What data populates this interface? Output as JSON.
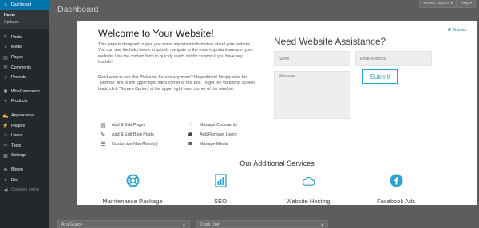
{
  "sidebar": {
    "items": [
      {
        "label": "Dashboard",
        "icon": "dashboard-icon",
        "glyph": "⌂",
        "current": true
      },
      {
        "label": "Posts",
        "icon": "pin-icon",
        "glyph": "✎"
      },
      {
        "label": "Media",
        "icon": "media-icon",
        "glyph": "♫"
      },
      {
        "label": "Pages",
        "icon": "pages-icon",
        "glyph": "▤"
      },
      {
        "label": "Comments",
        "icon": "comments-icon",
        "glyph": "✉"
      },
      {
        "label": "Projects",
        "icon": "projects-icon",
        "glyph": "✢"
      },
      {
        "label": "WooCommerce",
        "icon": "woocommerce-icon",
        "glyph": "◼"
      },
      {
        "label": "Products",
        "icon": "products-icon",
        "glyph": "●"
      },
      {
        "label": "Appearance",
        "icon": "appearance-icon",
        "glyph": "✍"
      },
      {
        "label": "Plugins",
        "icon": "plugins-icon",
        "glyph": "⚡"
      },
      {
        "label": "Users",
        "icon": "users-icon",
        "glyph": "☺"
      },
      {
        "label": "Tools",
        "icon": "tools-icon",
        "glyph": "✂"
      },
      {
        "label": "Settings",
        "icon": "settings-icon",
        "glyph": "▦"
      },
      {
        "label": "Bloom",
        "icon": "bloom-icon",
        "glyph": "✿"
      },
      {
        "label": "Divi",
        "icon": "divi-icon",
        "glyph": "◐"
      },
      {
        "label": "Collapse menu",
        "icon": "collapse-icon",
        "glyph": "◀"
      }
    ],
    "submenu": [
      "Home",
      "Updates"
    ]
  },
  "header": {
    "title": "Dashboard",
    "screen_options": "Screen Options ▾",
    "help": "Help ▾"
  },
  "welcome": {
    "title": "Welcome to Your Website!",
    "dismiss": "Dismiss",
    "intro": "This page is designed to give you some important information about your website. You can use the links below to quickly navigate to the most important areas of your website. Use the contact form to quickly reach out for support if you have any trouble!",
    "hint": "Don't want to see this Welcome Screen any more? No problem! Simply click the \"Dismiss\" link in the upper right hand corner of this box. To get the Welcome Screen back, click \"Screen Option\" at the upper right hand corner of the window.",
    "links": [
      {
        "label": "Add & Edit Pages",
        "icon": "pages-icon",
        "glyph": "▤"
      },
      {
        "label": "Add & Edit Blog Posts",
        "icon": "edit-icon",
        "glyph": "✎"
      },
      {
        "label": "Customize Nav Menu(s)",
        "icon": "menu-icon",
        "glyph": "☰"
      },
      {
        "label": "Manage Comments",
        "icon": "comment-icon",
        "glyph": "◌"
      },
      {
        "label": "Add/Remove Users",
        "icon": "user-icon",
        "glyph": "☗"
      },
      {
        "label": "Manage Media",
        "icon": "camera-icon",
        "glyph": "◙"
      }
    ]
  },
  "assistance": {
    "title": "Need Website Assistance?",
    "name_placeholder": "Name",
    "email_placeholder": "Email Address",
    "message_placeholder": "Message",
    "submit": "Submit"
  },
  "services": {
    "title": "Our Additional Services",
    "accent": "#2ea2cc",
    "items": [
      {
        "label": "Maintenance Package",
        "icon": "life-ring-icon"
      },
      {
        "label": "SEO",
        "icon": "bar-chart-icon"
      },
      {
        "label": "Website Hosting",
        "icon": "cloud-icon"
      },
      {
        "label": "Facebook Ads",
        "icon": "facebook-icon"
      }
    ]
  },
  "widgets": {
    "at_a_glance": "At a Glance",
    "quick_draft": "Quick Draft",
    "arrow": "▲"
  }
}
